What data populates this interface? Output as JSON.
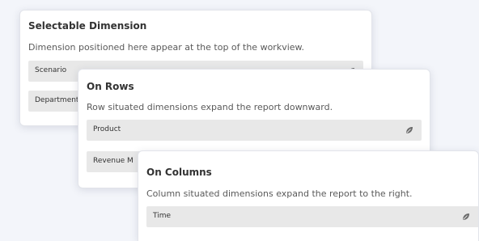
{
  "selectable_dimension": {
    "title": "Selectable Dimension",
    "description": "Dimension positioned here appear at the top of the workview.",
    "items": [
      {
        "label": "Scenario",
        "icon": "leaf-icon"
      },
      {
        "label": "Department",
        "icon": "leaf-icon"
      }
    ]
  },
  "on_rows": {
    "title": "On Rows",
    "description": "Row situated dimensions expand the report downward.",
    "items": [
      {
        "label": "Product",
        "icon": "leaf-icon"
      },
      {
        "label": "Revenue M",
        "icon": "leaf-icon"
      }
    ]
  },
  "on_columns": {
    "title": "On Columns",
    "description": "Column situated dimensions expand the report to the right.",
    "items": [
      {
        "label": "Time",
        "icon": "leaf-icon"
      }
    ]
  },
  "colors": {
    "background": "#f3f5fa",
    "card": "#ffffff",
    "row": "#e8e8e8",
    "icon": "#6a6a6a"
  }
}
